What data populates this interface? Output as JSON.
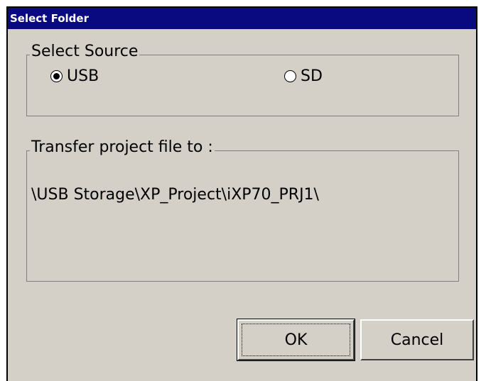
{
  "window": {
    "title": "Select Folder"
  },
  "source_group": {
    "label": "Select Source",
    "options": [
      {
        "label": "USB",
        "selected": true
      },
      {
        "label": "SD",
        "selected": false
      }
    ]
  },
  "transfer_group": {
    "label": "Transfer project file to :",
    "path": "\\USB Storage\\XP_Project\\iXP70_PRJ1\\"
  },
  "buttons": {
    "ok": "OK",
    "cancel": "Cancel"
  },
  "colors": {
    "titlebar": "#0a0a80",
    "face": "#d4d0c8"
  }
}
